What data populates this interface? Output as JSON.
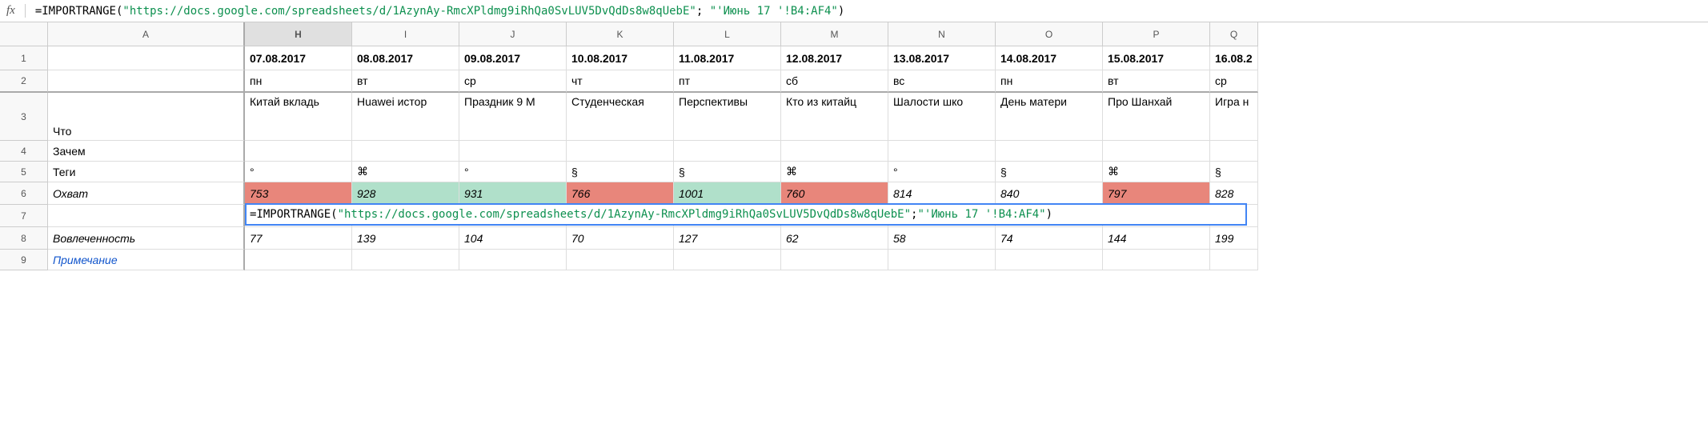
{
  "formula_bar": {
    "fx": "fx",
    "prefix": "=IMPORTRANGE(",
    "arg1": "\"https://docs.google.com/spreadsheets/d/1AzynAy-RmcXPldmg9iRhQa0SvLUV5DvQdDs8w8qUebE\"",
    "sep": "; ",
    "arg2": "\"'Июнь 17 '!B4:AF4\"",
    "suffix": ")"
  },
  "col_headers": [
    "A",
    "H",
    "I",
    "J",
    "K",
    "L",
    "M",
    "N",
    "O",
    "P",
    "Q"
  ],
  "row_headers": [
    "1",
    "2",
    "3",
    "4",
    "5",
    "6",
    "7",
    "8",
    "9"
  ],
  "labels": {
    "r3": "Что",
    "r4": "Зачем",
    "r5": "Теги",
    "r6": "Охват",
    "r7": "",
    "r8": "Вовлеченность",
    "r9": "Примечание"
  },
  "dates": [
    "07.08.2017",
    "08.08.2017",
    "09.08.2017",
    "10.08.2017",
    "11.08.2017",
    "12.08.2017",
    "13.08.2017",
    "14.08.2017",
    "15.08.2017",
    "16.08.2"
  ],
  "days": [
    "пн",
    "вт",
    "ср",
    "чт",
    "пт",
    "сб",
    "вс",
    "пн",
    "вт",
    "ср"
  ],
  "topics": [
    "Китай вкладь",
    "Huawei истор",
    "Праздник 9 М",
    "Студенческая",
    "Перспективы",
    "Кто из китайц",
    "Шалости шко",
    "День матери",
    "Про Шанхай",
    "Игра н"
  ],
  "tags": [
    "°",
    "⌘",
    "°",
    "§",
    "§",
    "⌘",
    "°",
    "§",
    "⌘",
    "§"
  ],
  "reach": [
    {
      "v": "753",
      "c": "red"
    },
    {
      "v": "928",
      "c": "green"
    },
    {
      "v": "931",
      "c": "green"
    },
    {
      "v": "766",
      "c": "red"
    },
    {
      "v": "1001",
      "c": "green"
    },
    {
      "v": "760",
      "c": "red"
    },
    {
      "v": "814",
      "c": ""
    },
    {
      "v": "840",
      "c": ""
    },
    {
      "v": "797",
      "c": "red"
    },
    {
      "v": "828",
      "c": ""
    }
  ],
  "engagement": [
    "77",
    "139",
    "104",
    "70",
    "127",
    "62",
    "58",
    "74",
    "144",
    "199"
  ],
  "editing": {
    "prefix": "=IMPORTRANGE(",
    "arg1": "\"https://docs.google.com/spreadsheets/d/1AzynAy-RmcXPldmg9iRhQa0SvLUV5DvQdDs8w8qUebE\"",
    "sep": "; ",
    "arg2": "\"'Июнь 17 '!B4:AF4\"",
    "suffix": ")"
  }
}
